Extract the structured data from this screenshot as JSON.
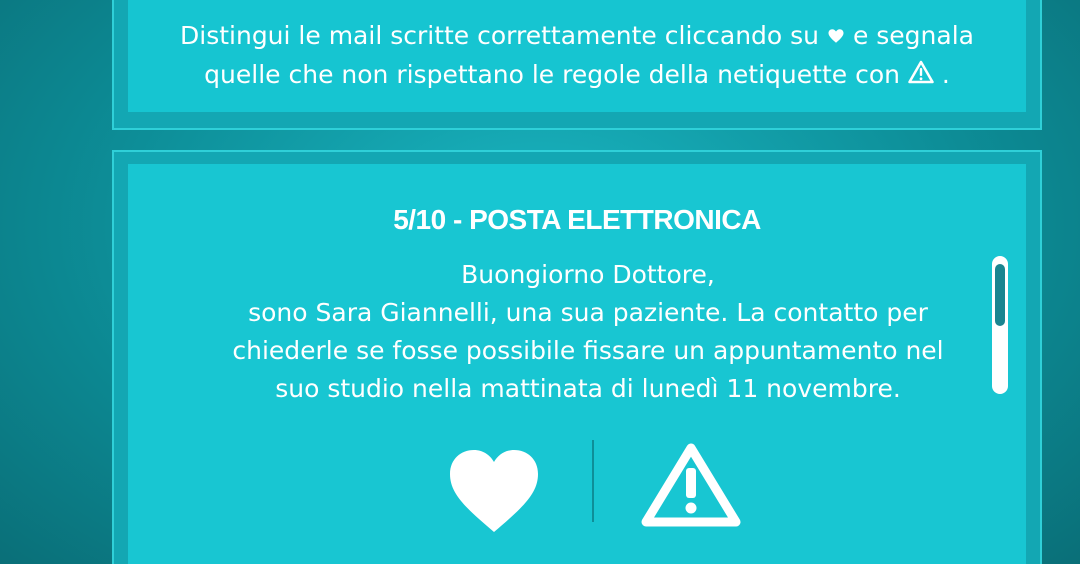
{
  "instructions": {
    "line1_a": "Distingui le mail scritte correttamente cliccando su",
    "line1_b": "e segnala",
    "line2_a": "quelle che non rispettano le regole della netiquette con",
    "line2_b": "."
  },
  "card": {
    "title": "5/10 - POSTA ELETTRONICA",
    "email_lines": [
      "Buongiorno Dottore,",
      "sono Sara Giannelli, una sua paziente. La contatto per",
      "chiederle se fosse possibile fissare un appuntamento nel",
      "suo studio nella mattinata di lunedì 11 novembre."
    ]
  },
  "actions": {
    "like_icon": "heart-icon",
    "report_icon": "warning-triangle-icon"
  },
  "colors": {
    "panel": "#18c6d2",
    "text": "#ffffff",
    "scroll_thumb": "#1a8590"
  }
}
